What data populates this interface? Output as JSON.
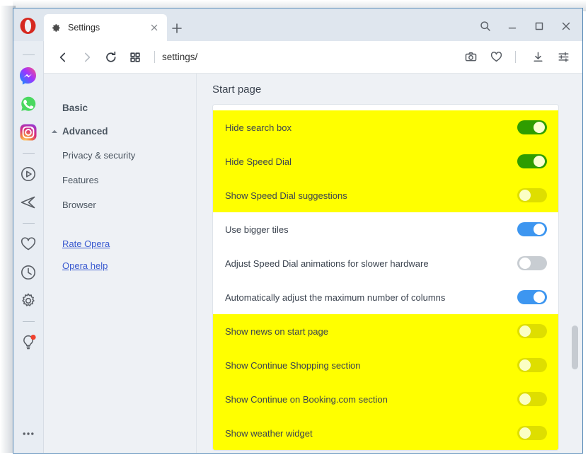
{
  "window": {
    "browser": "Opera",
    "logo_icon": "opera-logo",
    "controls": [
      {
        "name": "search-button",
        "icon": "search-icon"
      },
      {
        "name": "minimize-button",
        "icon": "minimize-icon"
      },
      {
        "name": "maximize-button",
        "icon": "maximize-icon"
      },
      {
        "name": "close-button",
        "icon": "close-icon"
      }
    ]
  },
  "tabs": {
    "active": {
      "title": "Settings",
      "favicon": "gear-icon",
      "close_icon": "close-icon"
    },
    "new_tab_icon": "plus-icon"
  },
  "addressbar": {
    "url": "settings/",
    "back_icon": "chevron-left-icon",
    "forward_icon": "chevron-right-icon",
    "reload_icon": "reload-icon",
    "speeddial_icon": "grid-icon",
    "right_icons": [
      {
        "name": "snapshot-button",
        "icon": "camera-icon"
      },
      {
        "name": "favorites-button",
        "icon": "heart-icon"
      },
      {
        "name": "downloads-button",
        "icon": "download-icon"
      },
      {
        "name": "easy-setup-button",
        "icon": "sliders-icon"
      }
    ]
  },
  "sidebar": {
    "items": [
      {
        "name": "messenger",
        "icon": "messenger-icon",
        "badge": false
      },
      {
        "name": "whatsapp",
        "icon": "whatsapp-icon",
        "badge": false
      },
      {
        "name": "instagram",
        "icon": "instagram-icon",
        "badge": false
      },
      {
        "name": "player",
        "icon": "play-circle-icon",
        "badge": false
      },
      {
        "name": "send",
        "icon": "send-icon",
        "badge": false
      },
      {
        "name": "bookmarks",
        "icon": "heart-icon",
        "badge": false
      },
      {
        "name": "history",
        "icon": "clock-icon",
        "badge": false
      },
      {
        "name": "settings",
        "icon": "gear-icon",
        "badge": false
      },
      {
        "name": "tips",
        "icon": "lightbulb-icon",
        "badge": true
      }
    ],
    "more_icon": "ellipsis-icon"
  },
  "settings_nav": {
    "basic_label": "Basic",
    "advanced_label": "Advanced",
    "advanced_expanded": true,
    "caret_icon": "caret-up-icon",
    "sub_items": [
      {
        "label": "Privacy & security"
      },
      {
        "label": "Features"
      },
      {
        "label": "Browser"
      }
    ],
    "links": [
      {
        "label": "Rate Opera"
      },
      {
        "label": "Opera help"
      }
    ]
  },
  "main": {
    "section_title": "Start page",
    "groups": [
      {
        "highlighted": true,
        "rows": [
          {
            "label": "Hide search box",
            "state": "on",
            "style": "green"
          },
          {
            "label": "Hide Speed Dial",
            "state": "on",
            "style": "green"
          },
          {
            "label": "Show Speed Dial suggestions",
            "state": "off",
            "style": "ylw"
          }
        ]
      },
      {
        "highlighted": false,
        "rows": [
          {
            "label": "Use bigger tiles",
            "state": "on",
            "style": "blue"
          },
          {
            "label": "Adjust Speed Dial animations for slower hardware",
            "state": "off",
            "style": "gray"
          },
          {
            "label": "Automatically adjust the maximum number of columns",
            "state": "on",
            "style": "blue"
          }
        ]
      },
      {
        "highlighted": true,
        "rows": [
          {
            "label": "Show news on start page",
            "state": "off",
            "style": "ylw"
          },
          {
            "label": "Show Continue Shopping section",
            "state": "off",
            "style": "ylw"
          },
          {
            "label": "Show Continue on Booking.com section",
            "state": "off",
            "style": "ylw"
          },
          {
            "label": "Show weather widget",
            "state": "off",
            "style": "ylw"
          }
        ]
      }
    ]
  },
  "colors": {
    "highlight": "#ffff00",
    "toggle_on_blue": "#3d96f0",
    "toggle_on_green": "#2f9d00",
    "toggle_off_gray": "#c8cdd2",
    "toggle_off_yellow": "#dede00",
    "link": "#3b5bd0",
    "opera_red": "#d6281f"
  }
}
